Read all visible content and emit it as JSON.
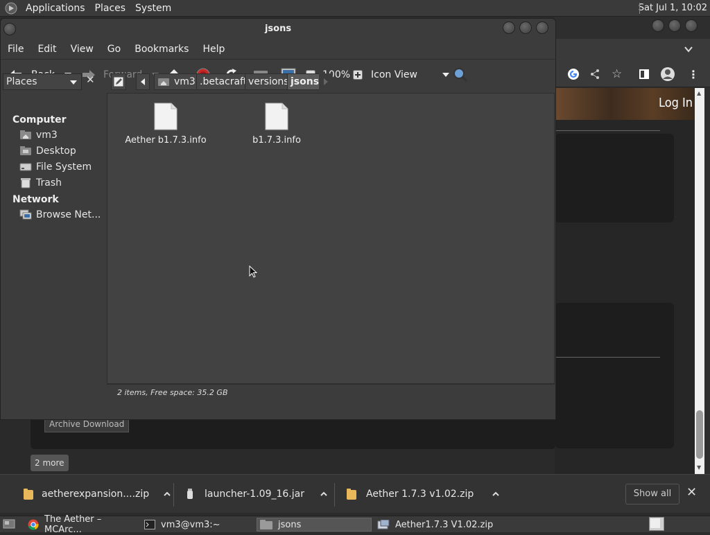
{
  "top_panel": {
    "menus": [
      "Applications",
      "Places",
      "System"
    ],
    "clock": "Sat Jul 1, 10:02"
  },
  "browser": {
    "login": "Log In",
    "archive_button": "Archive Download",
    "more_button": "2 more"
  },
  "downloads": {
    "items": [
      {
        "name": "aetherexpansion....zip",
        "icon": "zip-icon"
      },
      {
        "name": "launcher-1.09_16.jar",
        "icon": "jar-icon"
      },
      {
        "name": "Aether 1.7.3 v1.02.zip",
        "icon": "zip-icon"
      }
    ],
    "show_all": "Show all",
    "close": "✕"
  },
  "taskbar": {
    "tasks": [
      {
        "label": "The Aether – MCArc...",
        "icon": "chrome-icon"
      },
      {
        "label": "vm3@vm3:~",
        "icon": "terminal-icon"
      },
      {
        "label": "jsons",
        "icon": "folder-icon"
      },
      {
        "label": "Aether1.7.3 V1.02.zip",
        "icon": "archive-icon"
      }
    ]
  },
  "file_manager": {
    "title": "jsons",
    "menu": [
      "File",
      "Edit",
      "View",
      "Go",
      "Bookmarks",
      "Help"
    ],
    "toolbar": {
      "back": "Back",
      "forward": "Forward",
      "zoom": "100%",
      "view_mode": "Icon View"
    },
    "places_label": "Places",
    "breadcrumbs": [
      "vm3",
      ".betacraft",
      "versions",
      "jsons"
    ],
    "sidebar": {
      "computer_heading": "Computer",
      "computer_items": [
        {
          "label": "vm3",
          "icon": "home-folder-icon"
        },
        {
          "label": "Desktop",
          "icon": "desktop-folder-icon"
        },
        {
          "label": "File System",
          "icon": "drive-icon"
        },
        {
          "label": "Trash",
          "icon": "trash-icon"
        }
      ],
      "network_heading": "Network",
      "network_items": [
        {
          "label": "Browse Net...",
          "icon": "network-icon"
        }
      ]
    },
    "files": [
      {
        "name": "Aether b1.7.3.info",
        "icon": "file-icon"
      },
      {
        "name": "b1.7.3.info",
        "icon": "file-icon"
      }
    ],
    "status": "2 items, Free space: 35.2 GB"
  }
}
